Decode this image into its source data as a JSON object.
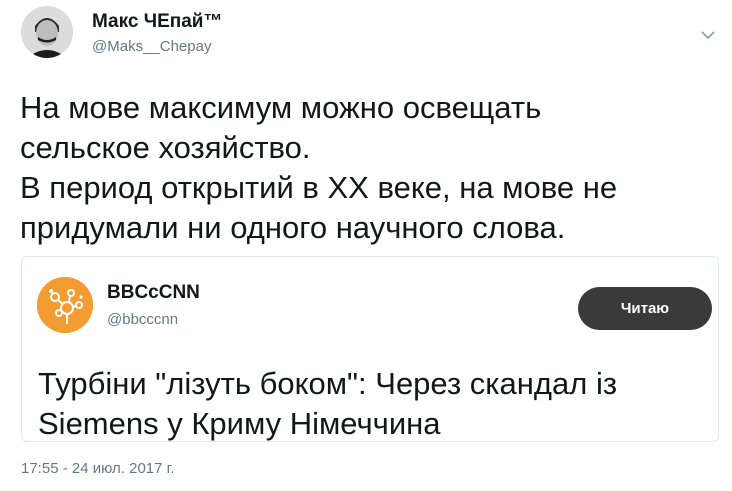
{
  "author": {
    "name": "Макс ЧЕпай™",
    "handle": "@Maks__Chepay"
  },
  "tweet": {
    "lines": [
      "На мове максимум можно освещать",
      "сельское хозяйство.",
      "В период открытий в XX веке, на мове не",
      "придумали ни одного научного слова."
    ]
  },
  "quoted": {
    "name": "BBCcCNN",
    "handle": "@bbcccnn",
    "button_label": "Читаю",
    "lines": [
      "Турбіни \"лізуть боком\": Через скандал із",
      "Siemens  у Криму Німеччина"
    ]
  },
  "timestamp": "17:55 - 24 июл. 2017 г.",
  "colors": {
    "text": "#14171a",
    "secondary": "#657786",
    "border": "#e1e8ed",
    "quote_avatar": "#f39c32",
    "button_bg": "#3a3a3a"
  },
  "icons": [
    "chevron-down-icon"
  ]
}
